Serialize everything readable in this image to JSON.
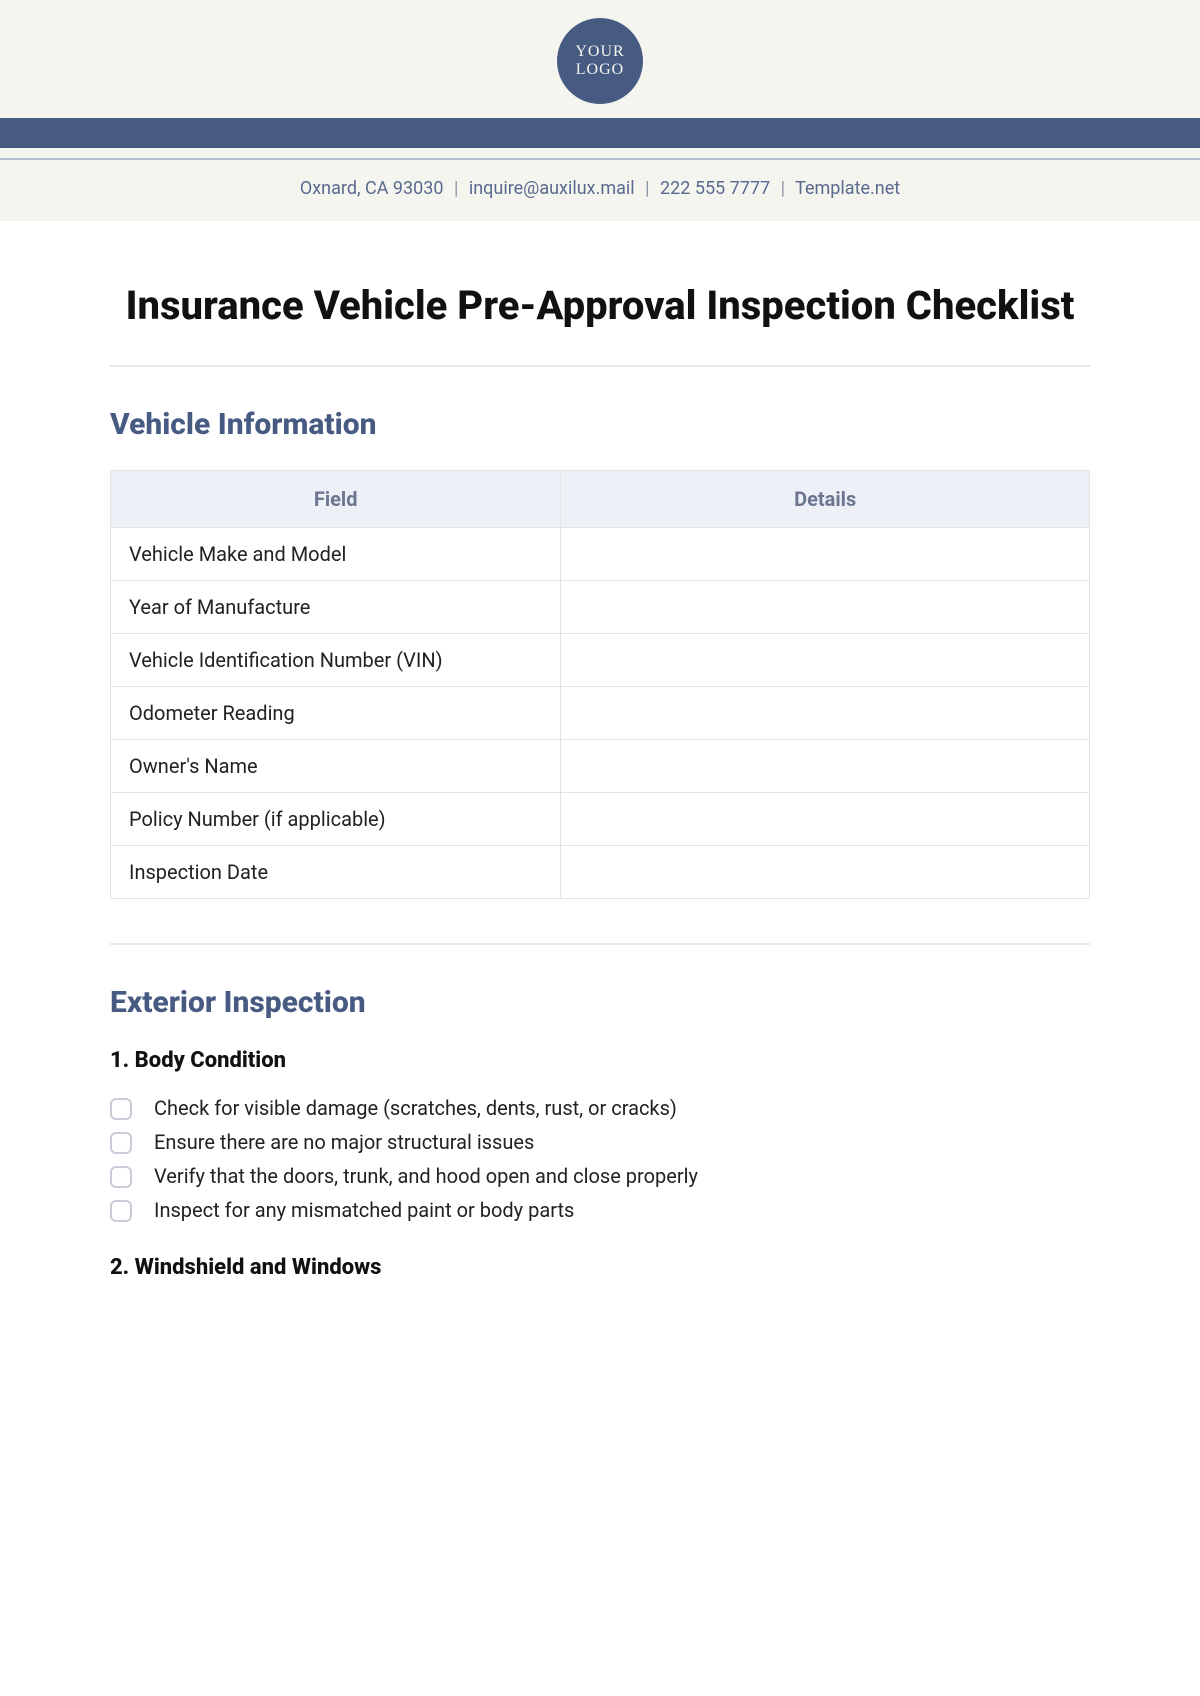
{
  "logo": {
    "line1": "YOUR",
    "line2": "LOGO"
  },
  "header": {
    "address": "Oxnard, CA 93030",
    "email": "inquire@auxilux.mail",
    "phone": "222 555 7777",
    "site": "Template.net"
  },
  "title": "Insurance Vehicle Pre-Approval Inspection Checklist",
  "sections": {
    "vehicleInfo": {
      "heading": "Vehicle Information",
      "columns": {
        "field": "Field",
        "details": "Details"
      },
      "rows": [
        {
          "field": "Vehicle Make and Model",
          "details": ""
        },
        {
          "field": "Year of Manufacture",
          "details": ""
        },
        {
          "field": "Vehicle Identification Number (VIN)",
          "details": ""
        },
        {
          "field": "Odometer Reading",
          "details": ""
        },
        {
          "field": "Owner's Name",
          "details": ""
        },
        {
          "field": "Policy Number (if applicable)",
          "details": ""
        },
        {
          "field": "Inspection Date",
          "details": ""
        }
      ]
    },
    "exterior": {
      "heading": "Exterior Inspection",
      "groups": [
        {
          "title": "1. Body Condition",
          "items": [
            "Check for visible damage (scratches, dents, rust, or cracks)",
            "Ensure there are no major structural issues",
            "Verify that the doors, trunk, and hood open and close properly",
            "Inspect for any mismatched paint or body parts"
          ]
        },
        {
          "title": "2. Windshield and Windows",
          "items": []
        }
      ]
    }
  }
}
